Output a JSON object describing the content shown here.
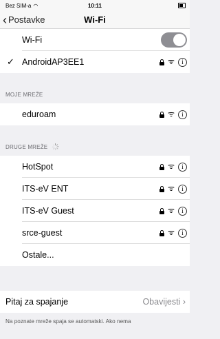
{
  "status": {
    "carrier": "Bez SIM-a",
    "time": "10:11"
  },
  "nav": {
    "back_label": "Postavke",
    "title": "Wi-Fi"
  },
  "wifi_toggle": {
    "label": "Wi-Fi",
    "on": true
  },
  "connected": {
    "name": "AndroidAP3EE1",
    "secured": true
  },
  "my_networks": {
    "header": "MOJE MREŽE",
    "items": [
      {
        "name": "eduroam",
        "secured": true
      }
    ]
  },
  "other_networks": {
    "header": "DRUGE MREŽE",
    "items": [
      {
        "name": "HotSpot",
        "secured": true
      },
      {
        "name": "ITS-eV ENT",
        "secured": true
      },
      {
        "name": "ITS-eV Guest",
        "secured": true
      },
      {
        "name": "srce-guest",
        "secured": true
      }
    ],
    "other_label": "Ostale..."
  },
  "ask_to_join": {
    "label": "Pitaj za spajanje",
    "value": "Obavijesti"
  },
  "footer_note": "Na poznate mreže spaja se automatski. Ako nema",
  "colors": {
    "toggle": "#8e8e93",
    "background": "#f0f0f3",
    "section_text": "#6d6d72"
  }
}
